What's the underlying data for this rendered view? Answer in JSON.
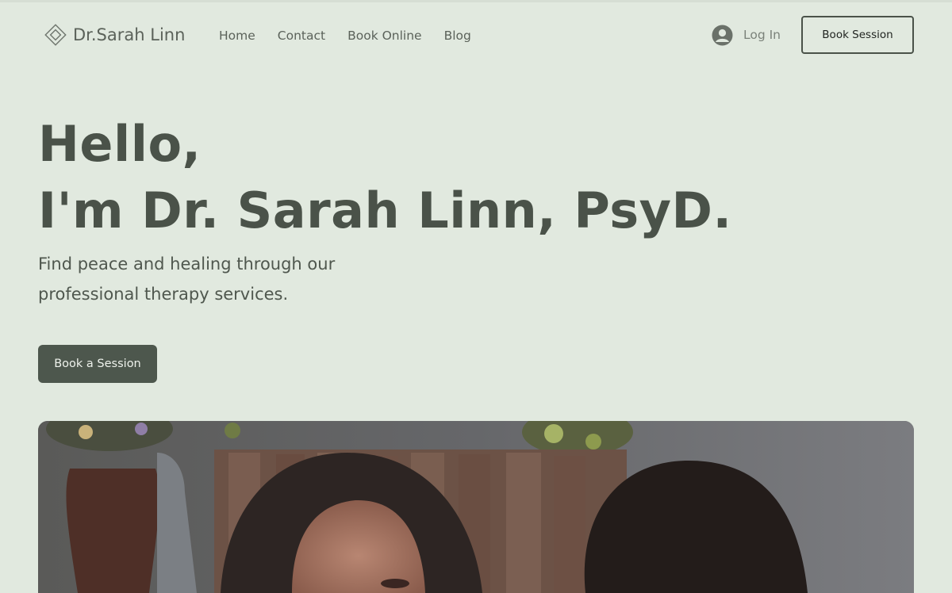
{
  "header": {
    "logo_text": "Dr.Sarah Linn",
    "nav": [
      "Home",
      "Contact",
      "Book Online",
      "Blog"
    ],
    "login_label": "Log In",
    "book_button": "Book Session"
  },
  "hero": {
    "title_line1": "Hello,",
    "title_line2": "I'm Dr. Sarah Linn, PsyD.",
    "subtitle": "Find peace and healing through our professional therapy services.",
    "cta": "Book a Session"
  },
  "icons": {
    "logo": "diamond-logo-icon",
    "login": "user-avatar-icon"
  },
  "colors": {
    "background": "#e1e9df",
    "text": "#4a5249",
    "button": "#4d574d"
  }
}
